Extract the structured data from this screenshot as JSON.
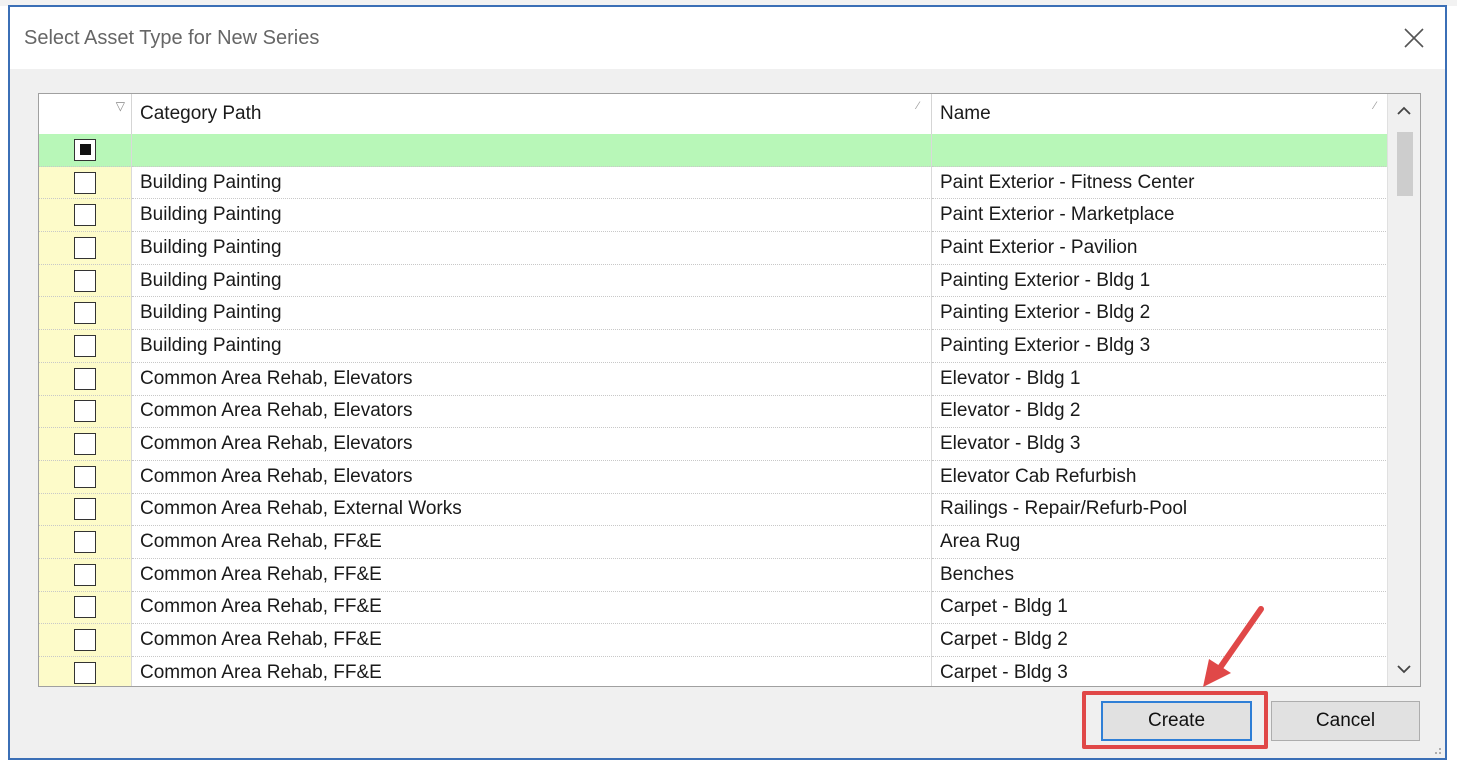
{
  "dialog": {
    "title": "Select Asset Type for New Series"
  },
  "grid": {
    "columns": [
      {
        "label": ""
      },
      {
        "label": "Category Path"
      },
      {
        "label": "Name"
      }
    ],
    "rows": [
      {
        "category": "Building Painting",
        "name": "Paint Exterior - Fitness Center"
      },
      {
        "category": "Building Painting",
        "name": "Paint Exterior - Marketplace"
      },
      {
        "category": "Building Painting",
        "name": "Paint Exterior - Pavilion"
      },
      {
        "category": "Building Painting",
        "name": "Painting Exterior - Bldg 1"
      },
      {
        "category": "Building Painting",
        "name": "Painting Exterior - Bldg 2"
      },
      {
        "category": "Building Painting",
        "name": "Painting Exterior - Bldg 3"
      },
      {
        "category": "Common Area Rehab, Elevators",
        "name": "Elevator - Bldg 1"
      },
      {
        "category": "Common Area Rehab, Elevators",
        "name": "Elevator - Bldg 2"
      },
      {
        "category": "Common Area Rehab, Elevators",
        "name": "Elevator - Bldg 3"
      },
      {
        "category": "Common Area Rehab, Elevators",
        "name": "Elevator Cab Refurbish"
      },
      {
        "category": "Common Area Rehab, External Works",
        "name": "Railings - Repair/Refurb-Pool"
      },
      {
        "category": "Common Area Rehab, FF&E",
        "name": "Area Rug"
      },
      {
        "category": "Common Area Rehab, FF&E",
        "name": "Benches"
      },
      {
        "category": "Common Area Rehab, FF&E",
        "name": "Carpet - Bldg 1"
      },
      {
        "category": "Common Area Rehab, FF&E",
        "name": "Carpet - Bldg 2"
      },
      {
        "category": "Common Area Rehab, FF&E",
        "name": "Carpet - Bldg 3"
      }
    ]
  },
  "buttons": {
    "create": "Create",
    "cancel": "Cancel"
  },
  "colors": {
    "dialog_border": "#3b6fb6",
    "new_row": "#b8f7b8",
    "checkbox_column": "#fdfbc9",
    "annotation": "#e04848",
    "default_button_border": "#2f7fd6"
  },
  "icons": {
    "close": "close-icon",
    "filter": "filter-icon",
    "scroll_up": "chevron-up-icon",
    "scroll_down": "chevron-down-icon",
    "annotation_arrow": "arrow-icon"
  }
}
